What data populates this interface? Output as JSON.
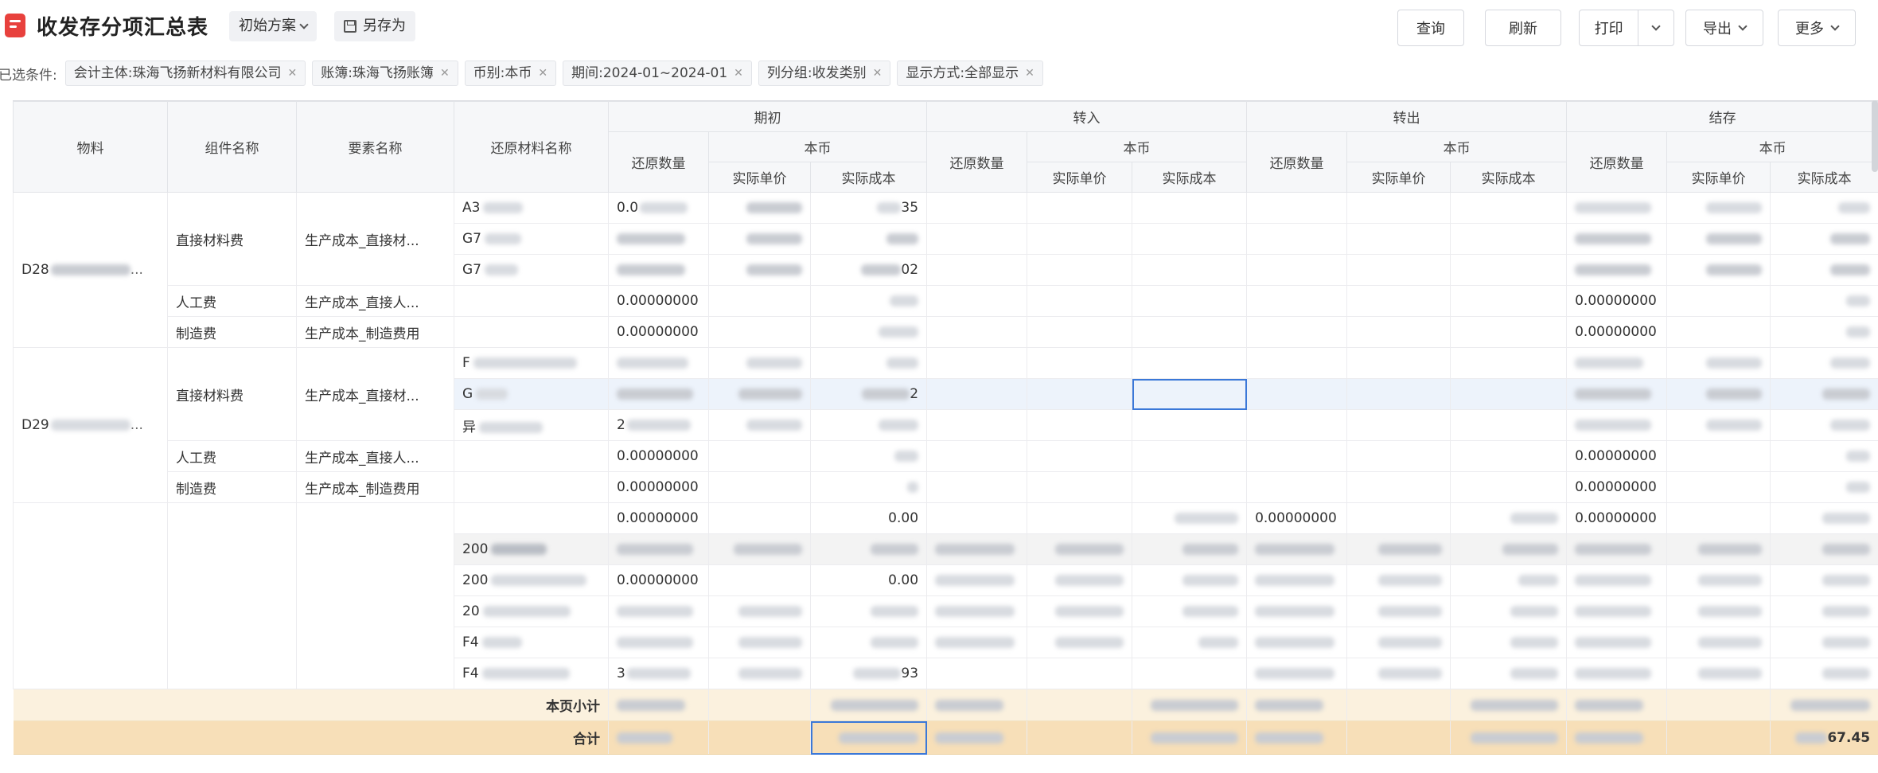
{
  "header": {
    "title": "收发存分项汇总表",
    "scheme_label": "初始方案",
    "saveas_label": "另存为",
    "query_label": "查询",
    "refresh_label": "刷新",
    "print_label": "打印",
    "export_label": "导出",
    "more_label": "更多"
  },
  "filters": {
    "label": "已选条件:",
    "chips": [
      "会计主体:珠海飞扬新材料有限公司",
      "账簿:珠海飞扬账簿",
      "币别:本币",
      "期间:2024-01~2024-01",
      "列分组:收发类别",
      "显示方式:全部显示"
    ]
  },
  "table": {
    "fixed_headers": [
      "物料",
      "组件名称",
      "要素名称",
      "还原材料名称"
    ],
    "groups": [
      "期初",
      "转入",
      "转出",
      "结存"
    ],
    "qty_label": "还原数量",
    "currency_label": "本币",
    "unit_price_label": "实际单价",
    "cost_label": "实际成本",
    "rows": [
      {
        "mat": "D28",
        "comp": "",
        "elem": "",
        "raw": "A3",
        "q0": "0.0",
        "c0": "35"
      },
      {
        "mat": "",
        "comp": "直接材料费",
        "elem": "生产成本_直接材...",
        "raw": "G7",
        "q0": "",
        "c0": ""
      },
      {
        "mat": "",
        "comp": "",
        "elem": "",
        "raw": "G7",
        "q0": "",
        "c0": "02"
      },
      {
        "mat": "",
        "comp": "人工费",
        "elem": "生产成本_直接人...",
        "raw": "",
        "q0": "0.00000000",
        "c0": ""
      },
      {
        "mat": "",
        "comp": "制造费",
        "elem": "生产成本_制造费用",
        "raw": "",
        "q0": "0.00000000",
        "c0": ""
      },
      {
        "mat": "D29",
        "comp": "",
        "elem": "",
        "raw": "F",
        "q0": "",
        "c0": ""
      },
      {
        "mat": "",
        "comp": "直接材料费",
        "elem": "生产成本_直接材...",
        "raw": "G",
        "q0": "",
        "c0": "2"
      },
      {
        "mat": "",
        "comp": "",
        "elem": "",
        "raw": "异",
        "q0": "2",
        "c0": ""
      },
      {
        "mat": "",
        "comp": "人工费",
        "elem": "生产成本_直接人...",
        "raw": "",
        "q0": "0.00000000",
        "c0": ""
      },
      {
        "mat": "",
        "comp": "制造费",
        "elem": "生产成本_制造费用",
        "raw": "",
        "q0": "0.00000000",
        "c0": ""
      },
      {
        "mat": "",
        "comp": "",
        "elem": "",
        "raw": "",
        "q0": "0.00000000",
        "c0": "0.00"
      },
      {
        "mat": "",
        "comp": "",
        "elem": "",
        "raw": "200",
        "q0": "",
        "c0": ""
      },
      {
        "mat": "",
        "comp": "",
        "elem": "",
        "raw": "200",
        "q0": "0.00000000",
        "c0": "0.00"
      },
      {
        "mat": "",
        "comp": "",
        "elem": "",
        "raw": "20",
        "q0": "",
        "c0": ""
      },
      {
        "mat": "",
        "comp": "",
        "elem": "",
        "raw": "F4",
        "q0": "",
        "c0": ""
      },
      {
        "mat": "",
        "comp": "",
        "elem": "",
        "raw": "F4",
        "q0": "3",
        "c0": "93"
      }
    ],
    "zero_qty": "0.00000000",
    "subtotal_label": "本页小计",
    "total_label": "合计",
    "total_tail": "67.45"
  }
}
